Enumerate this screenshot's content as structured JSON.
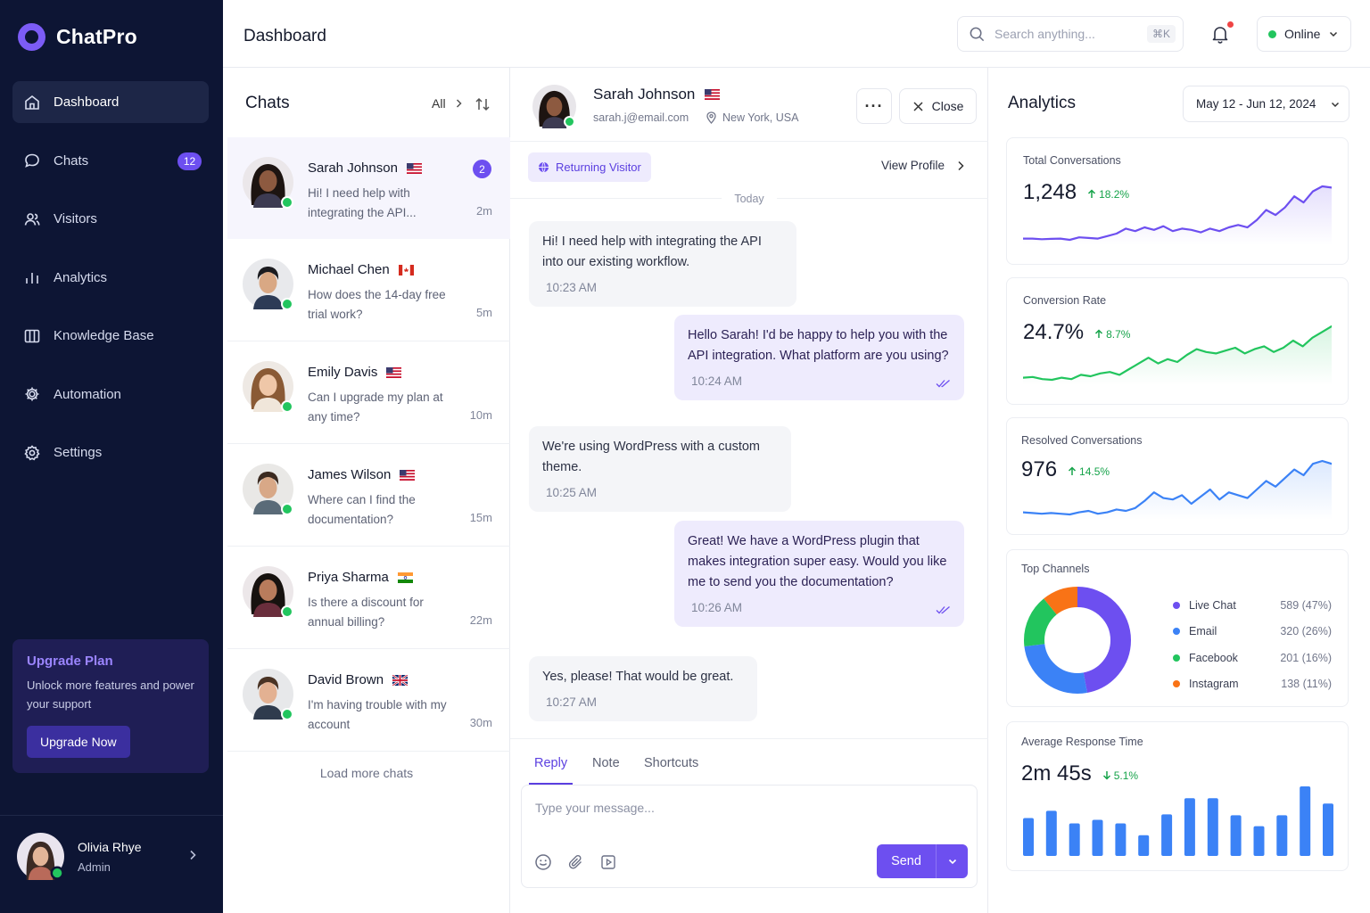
{
  "app": {
    "name": "ChatPro"
  },
  "sidebar": {
    "items": [
      {
        "label": "Dashboard",
        "icon": "dashboard-icon",
        "active": true
      },
      {
        "label": "Chats",
        "icon": "chat-icon",
        "badge": "12"
      },
      {
        "label": "Visitors",
        "icon": "users-icon"
      },
      {
        "label": "Analytics",
        "icon": "bar-chart-icon"
      },
      {
        "label": "Knowledge Base",
        "icon": "book-icon"
      },
      {
        "label": "Automation",
        "icon": "automation-gear-icon"
      },
      {
        "label": "Settings",
        "icon": "settings-gear-icon"
      }
    ],
    "upgrade": {
      "title": "Upgrade Plan",
      "text": "Unlock more features and power your support",
      "button": "Upgrade Now"
    },
    "user": {
      "name": "Olivia Rhye",
      "role": "Admin"
    }
  },
  "header": {
    "title": "Dashboard",
    "search_placeholder": "Search anything...",
    "shortcut": "⌘K",
    "status": "Online",
    "colors": {
      "online": "#22c55e",
      "notification": "#ef4444"
    }
  },
  "chats": {
    "title": "Chats",
    "filter": "All",
    "items": [
      {
        "name": "Sarah Johnson",
        "flag": "us",
        "message": "Hi! I need help with integrating the API...",
        "time": "2m",
        "unread": "2",
        "active": true
      },
      {
        "name": "Michael Chen",
        "flag": "ca",
        "message": "How does the 14-day free trial work?",
        "time": "5m"
      },
      {
        "name": "Emily Davis",
        "flag": "us",
        "message": "Can I upgrade my plan at any time?",
        "time": "10m"
      },
      {
        "name": "James Wilson",
        "flag": "us",
        "message": "Where can I find the documentation?",
        "time": "15m"
      },
      {
        "name": "Priya Sharma",
        "flag": "in",
        "message": "Is there a discount for annual billing?",
        "time": "22m"
      },
      {
        "name": "David Brown",
        "flag": "gb",
        "message": "I'm having trouble with my account",
        "time": "30m"
      }
    ],
    "load_more": "Load more chats"
  },
  "conversation": {
    "name": "Sarah Johnson",
    "flag": "us",
    "email": "sarah.j@email.com",
    "location": "New York, USA",
    "close_label": "Close",
    "more_label": "···",
    "visitor_tag": "Returning Visitor",
    "view_profile": "View Profile",
    "day_divider": "Today",
    "messages": [
      {
        "from": "visitor",
        "text": "Hi! I need help with integrating the API into our existing workflow.",
        "time": "10:23 AM"
      },
      {
        "from": "agent",
        "text": "Hello Sarah! I'd be happy to help you with the API integration. What platform are you using?",
        "time": "10:24 AM"
      },
      {
        "from": "visitor",
        "text": "We're using WordPress with a custom theme.",
        "time": "10:25 AM"
      },
      {
        "from": "agent",
        "text": "Great! We have a WordPress plugin that makes integration super easy. Would you like me to send you the documentation?",
        "time": "10:26 AM"
      },
      {
        "from": "visitor",
        "text": "Yes, please! That would be great.",
        "time": "10:27 AM"
      }
    ],
    "reply_tabs": [
      "Reply",
      "Note",
      "Shortcuts"
    ],
    "composer_placeholder": "Type your message...",
    "send_label": "Send",
    "accent": "#6d4ff0"
  },
  "analytics": {
    "title": "Analytics",
    "date_range": "May 12 - Jun 12, 2024",
    "total_conversations": {
      "label": "Total Conversations",
      "value": "1,248",
      "delta": "18.2%",
      "direction": "up",
      "color": "#6d4ff0",
      "series": [
        4,
        4,
        3.5,
        3.8,
        4,
        3,
        5,
        4.5,
        4,
        6,
        8,
        12,
        10,
        13,
        11,
        14,
        10,
        12,
        11,
        9,
        12,
        10,
        13,
        15,
        13,
        19,
        27,
        23,
        29,
        38,
        33,
        42,
        46,
        45
      ]
    },
    "conversion_rate": {
      "label": "Conversion Rate",
      "value": "24.7%",
      "delta": "8.7%",
      "direction": "up",
      "color": "#22c55e",
      "series": [
        10,
        10.5,
        9,
        8.5,
        10,
        9,
        12,
        11,
        13,
        14,
        12,
        16,
        20,
        24,
        20,
        23,
        21,
        26,
        30,
        28,
        27,
        29,
        31,
        27,
        30,
        32,
        28,
        31,
        36,
        32,
        38,
        42,
        46
      ]
    },
    "resolved_conversations": {
      "label": "Resolved Conversations",
      "value": "976",
      "delta": "14.5%",
      "direction": "up",
      "color": "#3b82f6",
      "series": [
        6,
        5.5,
        5,
        5.5,
        5,
        4.5,
        6,
        7,
        5,
        6,
        8,
        7,
        9,
        14,
        20,
        16,
        15,
        18,
        12,
        17,
        22,
        15,
        20,
        18,
        16,
        22,
        28,
        24,
        30,
        36,
        32,
        40,
        42,
        40
      ]
    },
    "top_channels": {
      "label": "Top Channels",
      "items": [
        {
          "name": "Live Chat",
          "value": "589 (47%)",
          "share": 47,
          "color": "#6d4ff0"
        },
        {
          "name": "Email",
          "value": "320 (26%)",
          "share": 26,
          "color": "#3b82f6"
        },
        {
          "name": "Facebook",
          "value": "201 (16%)",
          "share": 16,
          "color": "#22c55e"
        },
        {
          "name": "Instagram",
          "value": "138 (11%)",
          "share": 11,
          "color": "#f97316"
        }
      ]
    },
    "avg_response_time": {
      "label": "Average Response Time",
      "value": "2m 45s",
      "delta": "5.1%",
      "direction": "down",
      "color": "#3b82f6",
      "bars": [
        42,
        50,
        36,
        40,
        36,
        23,
        46,
        64,
        64,
        45,
        33,
        45,
        77,
        58
      ]
    }
  }
}
